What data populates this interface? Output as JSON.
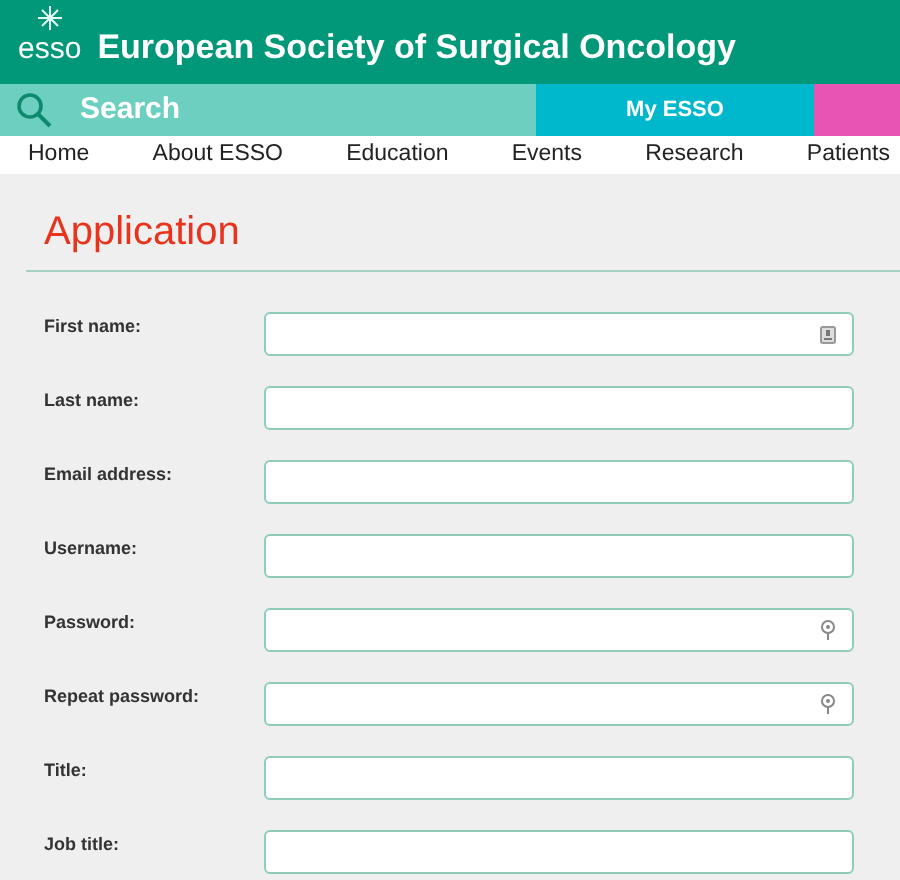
{
  "header": {
    "logo_text": "esso",
    "title": "European Society of Surgical Oncology"
  },
  "search": {
    "placeholder": "Search"
  },
  "my_esso": "My ESSO",
  "nav": [
    "Home",
    "About ESSO",
    "Education",
    "Events",
    "Research",
    "Patients"
  ],
  "heading": "Application",
  "fields": [
    {
      "label": "First name:",
      "kind": "contact"
    },
    {
      "label": "Last name:",
      "kind": "plain"
    },
    {
      "label": "Email address:",
      "kind": "plain"
    },
    {
      "label": "Username:",
      "kind": "plain"
    },
    {
      "label": "Password:",
      "kind": "password"
    },
    {
      "label": "Repeat password:",
      "kind": "password"
    },
    {
      "label": "Title:",
      "kind": "plain"
    },
    {
      "label": "Job title:",
      "kind": "plain"
    }
  ]
}
